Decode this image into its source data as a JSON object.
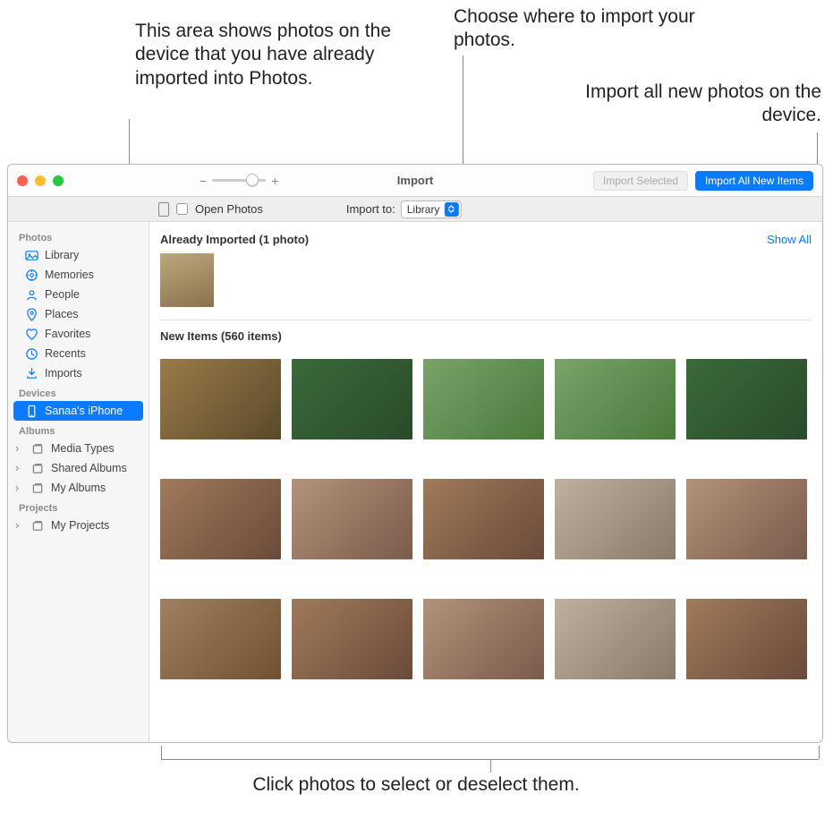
{
  "callouts": {
    "already_area": "This area shows photos on the device that you have already imported into Photos.",
    "choose_where": "Choose where to import your photos.",
    "import_all": "Import all new photos on the device.",
    "click_select": "Click photos to select or deselect them."
  },
  "titlebar": {
    "title": "Import",
    "zoom_minus": "−",
    "zoom_plus": "+",
    "import_selected": "Import Selected",
    "import_all_new": "Import All New Items"
  },
  "subbar": {
    "open_photos": "Open Photos",
    "import_to_label": "Import to:",
    "import_to_value": "Library"
  },
  "sidebar": {
    "sections": {
      "photos": "Photos",
      "devices": "Devices",
      "albums": "Albums",
      "projects": "Projects"
    },
    "items": {
      "library": "Library",
      "memories": "Memories",
      "people": "People",
      "places": "Places",
      "favorites": "Favorites",
      "recents": "Recents",
      "imports": "Imports",
      "device": "Sanaa's iPhone",
      "media_types": "Media Types",
      "shared_albums": "Shared Albums",
      "my_albums": "My Albums",
      "my_projects": "My Projects"
    }
  },
  "content": {
    "already_header": "Already Imported (1 photo)",
    "show_all": "Show All",
    "new_items_header": "New Items (560 items)"
  }
}
